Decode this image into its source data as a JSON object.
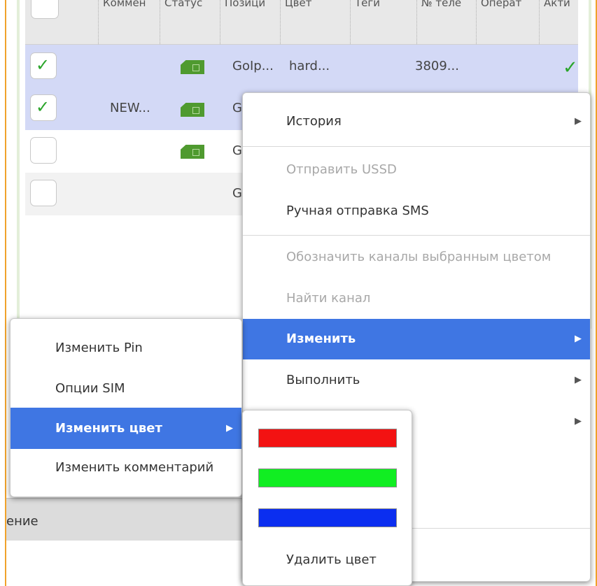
{
  "table": {
    "columns": [
      "Коммен",
      "Статус",
      "Позици",
      "Цвет",
      "Теги",
      "№ теле",
      "Операт",
      "Акти"
    ],
    "rows": [
      {
        "comment": "",
        "position": "GoIp...",
        "color": "hard...",
        "phone": "3809..."
      },
      {
        "comment": "NEW...",
        "position": "G"
      },
      {
        "comment": "",
        "position": "G"
      },
      {
        "comment": "",
        "position": "G"
      }
    ]
  },
  "status_bar": {
    "text": "ение"
  },
  "context_menu": {
    "items": [
      "История",
      "Отправить USSD",
      "Ручная отправка SMS",
      "Обозначить каналы выбранным цветом",
      "Найти канал",
      "Изменить",
      "Выполнить"
    ]
  },
  "submenu": {
    "items": [
      "Изменить Pin",
      "Опции SIM",
      "Изменить цвет",
      "Изменить комментарий"
    ]
  },
  "color_menu": {
    "colors": [
      "#f31212",
      "#11ee22",
      "#0b2ef0"
    ],
    "remove_label": "Удалить цвет"
  },
  "icons": {
    "check": "check-icon",
    "sim": "sim-card-icon",
    "arrow": "submenu-arrow-icon"
  }
}
